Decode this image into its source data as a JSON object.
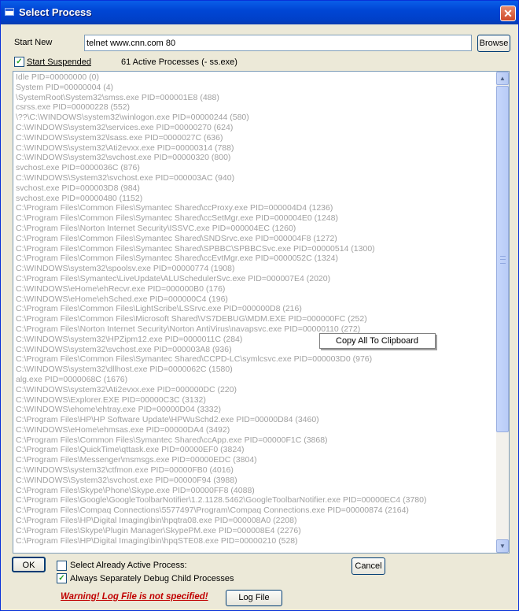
{
  "window": {
    "title": "Select Process",
    "close_label": "✕"
  },
  "start_new": {
    "label": "Start New",
    "value": "telnet www.cnn.com 80",
    "browse_label": "Browse"
  },
  "start_suspended": {
    "label": "Start Suspended",
    "checked": true,
    "check_mark": "✓"
  },
  "active_processes": "61  Active Processes (- ss.exe)",
  "processes": [
    "Idle  PID=00000000 (0)",
    "System  PID=00000004 (4)",
    "\\SystemRoot\\System32\\smss.exe  PID=000001E8 (488)",
    "csrss.exe  PID=00000228 (552)",
    "\\??\\C:\\WINDOWS\\system32\\winlogon.exe  PID=00000244 (580)",
    "C:\\WINDOWS\\system32\\services.exe  PID=00000270 (624)",
    "C:\\WINDOWS\\system32\\lsass.exe  PID=0000027C (636)",
    "C:\\WINDOWS\\system32\\Ati2evxx.exe  PID=00000314 (788)",
    "C:\\WINDOWS\\system32\\svchost.exe  PID=00000320 (800)",
    "svchost.exe  PID=0000036C (876)",
    "C:\\WINDOWS\\System32\\svchost.exe  PID=000003AC (940)",
    "svchost.exe  PID=000003D8 (984)",
    "svchost.exe  PID=00000480 (1152)",
    "C:\\Program Files\\Common Files\\Symantec Shared\\ccProxy.exe  PID=000004D4 (1236)",
    "C:\\Program Files\\Common Files\\Symantec Shared\\ccSetMgr.exe  PID=000004E0 (1248)",
    "C:\\Program Files\\Norton Internet Security\\ISSVC.exe  PID=000004EC (1260)",
    "C:\\Program Files\\Common Files\\Symantec Shared\\SNDSrvc.exe  PID=000004F8 (1272)",
    "C:\\Program Files\\Common Files\\Symantec Shared\\SPBBC\\SPBBCSvc.exe  PID=00000514 (1300)",
    "C:\\Program Files\\Common Files\\Symantec Shared\\ccEvtMgr.exe  PID=0000052C (1324)",
    "C:\\WINDOWS\\system32\\spoolsv.exe  PID=00000774 (1908)",
    "C:\\Program Files\\Symantec\\LiveUpdate\\ALUSchedulerSvc.exe  PID=000007E4 (2020)",
    "C:\\WINDOWS\\eHome\\ehRecvr.exe  PID=000000B0 (176)",
    "C:\\WINDOWS\\eHome\\ehSched.exe  PID=000000C4 (196)",
    "C:\\Program Files\\Common Files\\LightScribe\\LSSrvc.exe  PID=000000D8 (216)",
    "C:\\Program Files\\Common Files\\Microsoft Shared\\VS7DEBUG\\MDM.EXE  PID=000000FC (252)",
    "C:\\Program Files\\Norton Internet Security\\Norton AntiVirus\\navapsvc.exe  PID=00000110 (272)",
    "C:\\WINDOWS\\system32\\HPZipm12.exe  PID=0000011C (284)",
    "C:\\WINDOWS\\system32\\svchost.exe  PID=000003A8 (936)",
    "C:\\Program Files\\Common Files\\Symantec Shared\\CCPD-LC\\symlcsvc.exe  PID=000003D0 (976)",
    "C:\\WINDOWS\\system32\\dllhost.exe  PID=0000062C (1580)",
    "alg.exe  PID=0000068C (1676)",
    "C:\\WINDOWS\\system32\\Ati2evxx.exe  PID=000000DC (220)",
    "C:\\WINDOWS\\Explorer.EXE  PID=00000C3C (3132)",
    "C:\\WINDOWS\\ehome\\ehtray.exe  PID=00000D04 (3332)",
    "C:\\Program Files\\HP\\HP Software Update\\HPWuSchd2.exe  PID=00000D84 (3460)",
    "C:\\WINDOWS\\eHome\\ehmsas.exe  PID=00000DA4 (3492)",
    "C:\\Program Files\\Common Files\\Symantec Shared\\ccApp.exe  PID=00000F1C (3868)",
    "C:\\Program Files\\QuickTime\\qttask.exe  PID=00000EF0 (3824)",
    "C:\\Program Files\\Messenger\\msmsgs.exe  PID=00000EDC (3804)",
    "C:\\WINDOWS\\system32\\ctfmon.exe  PID=00000FB0 (4016)",
    "C:\\WINDOWS\\System32\\svchost.exe  PID=00000F94 (3988)",
    "C:\\Program Files\\Skype\\Phone\\Skype.exe  PID=00000FF8 (4088)",
    "C:\\Program Files\\Google\\GoogleToolbarNotifier\\1.2.1128.5462\\GoogleToolbarNotifier.exe  PID=00000EC4 (3780)",
    "C:\\Program Files\\Compaq Connections\\5577497\\Program\\Compaq Connections.exe  PID=00000874 (2164)",
    "C:\\Program Files\\HP\\Digital Imaging\\bin\\hpqtra08.exe  PID=000008A0 (2208)",
    "C:\\Program Files\\Skype\\Plugin Manager\\SkypePM.exe  PID=000008E4 (2276)",
    "C:\\Program Files\\HP\\Digital Imaging\\bin\\hpqSTE08.exe  PID=00000210 (528)"
  ],
  "scrollbar": {
    "up_arrow": "▲",
    "down_arrow": "▼"
  },
  "context_menu": {
    "copy_all_label": "Copy All To Clipboard"
  },
  "footer": {
    "ok_label": "OK",
    "cancel_label": "Cancel",
    "select_active_label": "Select Already Active Process:",
    "select_active_checked": false,
    "debug_child_label": "Always Separately Debug Child Processes",
    "debug_child_checked": true,
    "check_mark": "✓",
    "warning": "Warning! Log File is not specified!",
    "log_file_label": "Log File"
  },
  "colors": {
    "title_bar": "#0046d5",
    "warning": "#c00000",
    "list_text": "#a0a0a0",
    "dialog_bg": "#ece9d8"
  }
}
